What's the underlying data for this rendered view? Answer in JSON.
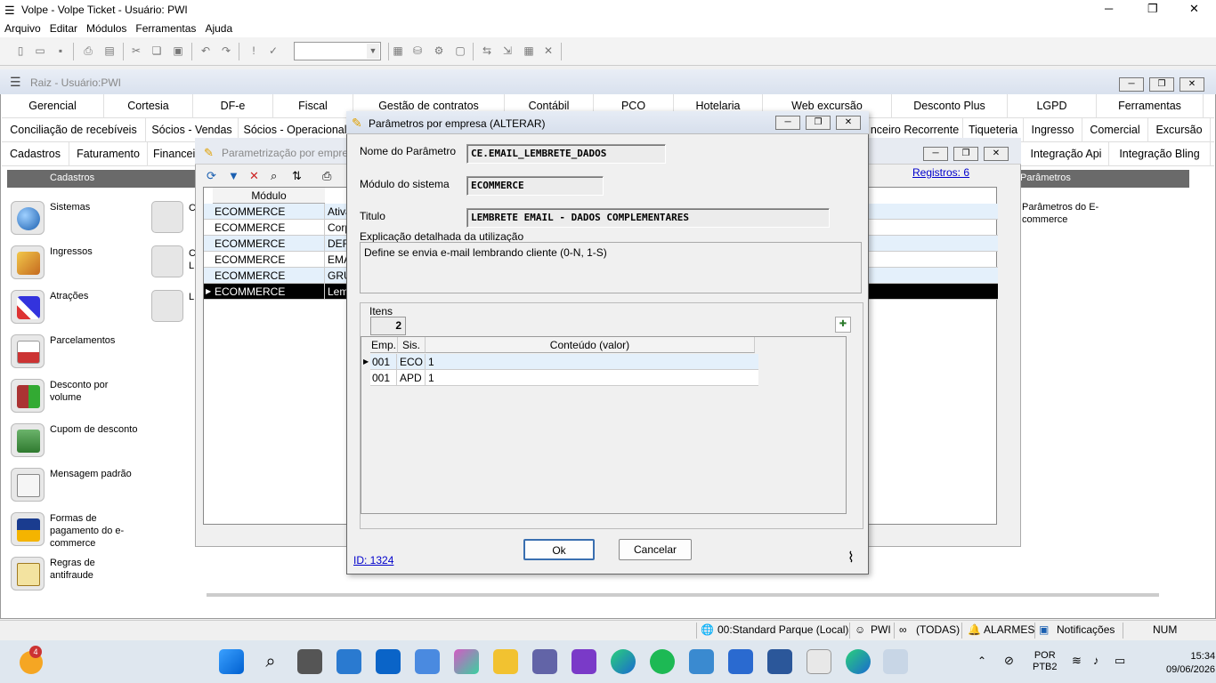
{
  "window": {
    "title": "Volpe - Volpe Ticket - Usuário: PWI"
  },
  "menu": [
    "Arquivo",
    "Editar",
    "Módulos",
    "Ferramentas",
    "Ajuda"
  ],
  "mdi": {
    "title": "Raiz - Usuário:PWI"
  },
  "tabs_row1": [
    "Gerencial",
    "Cortesia",
    "DF-e",
    "Fiscal",
    "Gestão de contratos",
    "Contábil",
    "PCO",
    "Hotelaria",
    "Web excursão",
    "Desconto Plus",
    "LGPD",
    "Ferramentas"
  ],
  "tabs_row2": [
    "Conciliação de recebíveis",
    "Sócios - Vendas",
    "Sócios - Operacional",
    "nceiro Recorrente",
    "Tiqueteria",
    "Ingresso",
    "Comercial",
    "Excursão"
  ],
  "tabs_row3": [
    "Cadastros",
    "Faturamento",
    "Financei",
    "Integração Api",
    "Integração Bling"
  ],
  "panel": {
    "header_left": "Cadastros",
    "header_right": "Parâmetros",
    "right_item": "Parâmetros do E-commerce"
  },
  "left_items": [
    "Sistemas",
    "Ingressos",
    "Atrações",
    "Parcelamentos",
    "Desconto por volume",
    "Cupom de desconto",
    "Mensagem padrão",
    "Formas de pagamento do e-commerce",
    "Regras de antifraude"
  ],
  "col2_letters": [
    "C",
    "C L",
    "L"
  ],
  "backwin": {
    "title": "Parametrização por empre",
    "records": "Registros: 6",
    "col_modulo": "Módulo",
    "rows": [
      {
        "m": "ECOMMERCE",
        "d": "Ativa"
      },
      {
        "m": "ECOMMERCE",
        "d": "Corp"
      },
      {
        "m": "ECOMMERCE",
        "d": "DEF"
      },
      {
        "m": "ECOMMERCE",
        "d": "EMA"
      },
      {
        "m": "ECOMMERCE",
        "d": "GRU"
      },
      {
        "m": "ECOMMERCE",
        "d": "Lem"
      }
    ]
  },
  "dialog": {
    "title": "Parâmetros por empresa (ALTERAR)",
    "nome_label": "Nome do Parâmetro",
    "nome_value": "CE.EMAIL_LEMBRETE_DADOS",
    "modulo_label": "Módulo do sistema",
    "modulo_value": "ECOMMERCE",
    "titulo_label": "Titulo",
    "titulo_value": "LEMBRETE EMAIL - DADOS COMPLEMENTARES",
    "expl_label": "Explicação detalhada da utilização",
    "expl_value": "Define se envia e-mail lembrando cliente (0-N, 1-S)",
    "itens_label": "Itens",
    "itens_count": "2",
    "col_emp": "Emp.",
    "col_sis": "Sis.",
    "col_conteudo": "Conteúdo (valor)",
    "items": [
      {
        "emp": "001",
        "sis": "ECO",
        "val": "1"
      },
      {
        "emp": "001",
        "sis": "APD",
        "val": "1"
      }
    ],
    "ok": "Ok",
    "cancel": "Cancelar",
    "id": "ID: 1324"
  },
  "status": {
    "local": "00:Standard Parque (Local)",
    "user": "PWI",
    "todas": "(TODAS)",
    "alarmes": "ALARMES",
    "notif": "Notificações",
    "num": "NUM"
  },
  "taskbar": {
    "badge": "4",
    "lang1": "POR",
    "lang2": "PTB2",
    "time": "15:34",
    "date": "09/06/2026"
  }
}
